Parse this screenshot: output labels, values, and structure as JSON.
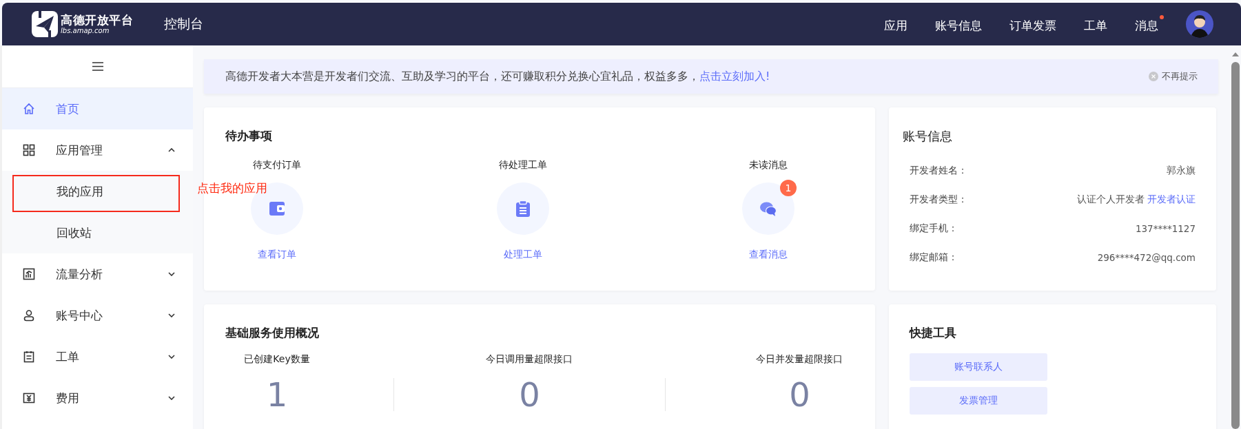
{
  "header": {
    "logo_title": "高德开放平台",
    "logo_subtitle": "lbs.amap.com",
    "title": "控制台",
    "nav": [
      {
        "label": "应用",
        "dot": false
      },
      {
        "label": "账号信息",
        "dot": false
      },
      {
        "label": "订单发票",
        "dot": false
      },
      {
        "label": "工单",
        "dot": false
      },
      {
        "label": "消息",
        "dot": true
      }
    ]
  },
  "sidebar": {
    "items": [
      {
        "kind": "link",
        "label": "首页",
        "selected": true
      },
      {
        "kind": "group",
        "label": "应用管理",
        "selected": false,
        "expanded": true,
        "children": [
          {
            "label": "我的应用",
            "selected": false,
            "highlighted": true,
            "note": "点击我的应用"
          },
          {
            "label": "回收站",
            "selected": false,
            "highlighted": false
          }
        ]
      },
      {
        "kind": "group",
        "label": "流量分析",
        "selected": false,
        "expanded": false
      },
      {
        "kind": "group",
        "label": "账号中心",
        "selected": false,
        "expanded": false
      },
      {
        "kind": "group",
        "label": "工单",
        "selected": false,
        "expanded": false
      },
      {
        "kind": "group",
        "label": "费用",
        "selected": false,
        "expanded": false
      }
    ]
  },
  "banner": {
    "text": "高德开发者大本营是开发者们交流、互助及学习的平台，还可赚取积分兑换心宜礼品，权益多多，",
    "link": "点击立刻加入!",
    "dismiss": "不再提示"
  },
  "todo": {
    "title": "待办事项",
    "items": [
      {
        "label": "待支付订单",
        "action": "查看订单"
      },
      {
        "label": "待处理工单",
        "action": "处理工单"
      },
      {
        "label": "未读消息",
        "action": "查看消息",
        "badge": "1"
      }
    ]
  },
  "account": {
    "title": "账号信息",
    "rows": [
      {
        "label": "开发者姓名：",
        "value": "郭永旗"
      },
      {
        "label": "开发者类型：",
        "value": "认证个人开发者",
        "link": "开发者认证"
      },
      {
        "label": "绑定手机：",
        "value": "137****1127"
      },
      {
        "label": "绑定邮箱：",
        "value": "296****472@qq.com"
      }
    ]
  },
  "usage": {
    "title": "基础服务使用概况",
    "stats": [
      {
        "label": "已创建Key数量",
        "value": "1"
      },
      {
        "label": "今日调用量超限接口",
        "value": "0"
      },
      {
        "label": "今日并发量超限接口",
        "value": "0"
      }
    ]
  },
  "tools": {
    "title": "快捷工具",
    "buttons": [
      "账号联系人",
      "发票管理"
    ]
  }
}
